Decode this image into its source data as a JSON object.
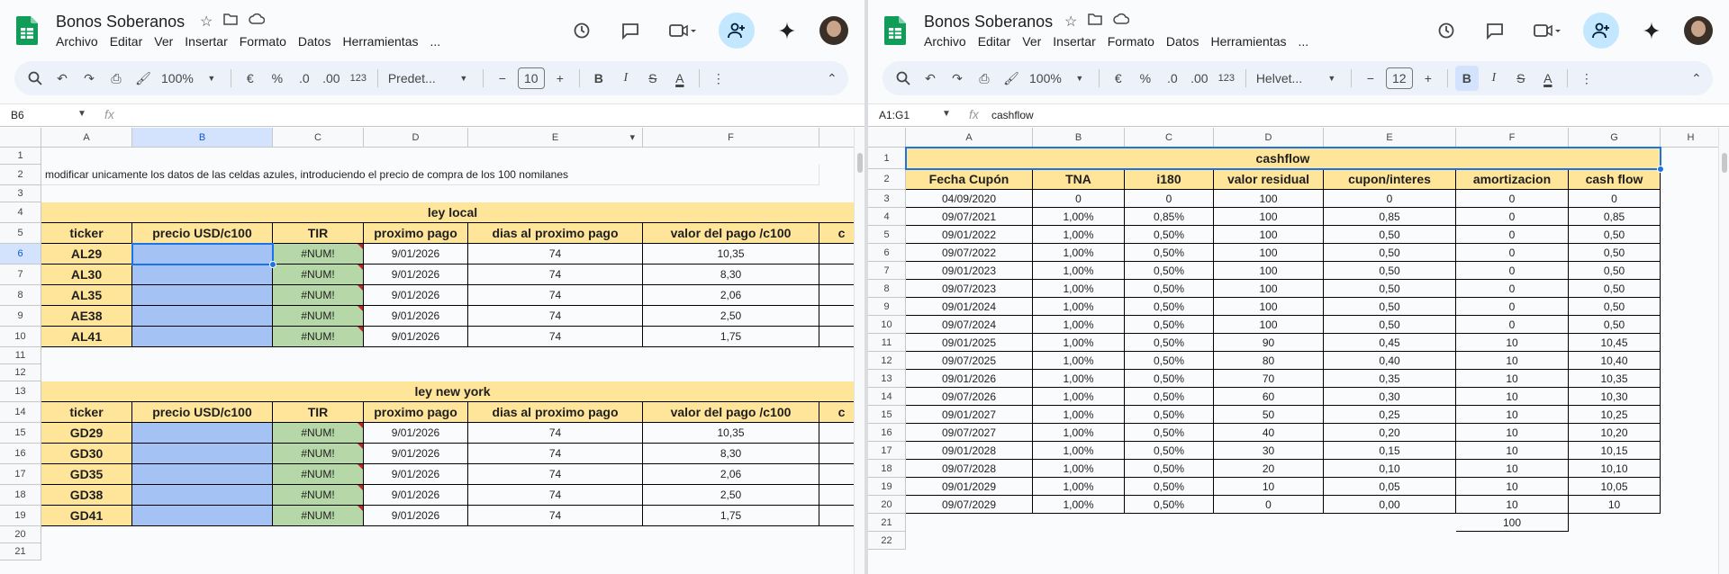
{
  "colors": {
    "accent": "#1a73e8",
    "yellow": "#ffe599",
    "blue_cell": "#a4c2f4",
    "green_cell": "#b6d7a8",
    "sheets_green": "#0f9d58"
  },
  "left": {
    "title": "Bonos Soberanos",
    "menus": [
      "Archivo",
      "Editar",
      "Ver",
      "Insertar",
      "Formato",
      "Datos",
      "Herramientas",
      "..."
    ],
    "toolbar": {
      "zoom": "100%",
      "currency": "€",
      "percent": "%",
      "dec_less": ".0",
      "dec_more": ".00",
      "num_format": "123",
      "font": "Predet...",
      "font_size": "10",
      "bold": "B",
      "italic": "I",
      "strike": "S",
      "textcolor": "A"
    },
    "namebox": "B6",
    "formula": "",
    "cols": [
      "A",
      "B",
      "C",
      "D",
      "E",
      "F",
      ""
    ],
    "rows": [
      "1",
      "2",
      "3",
      "4",
      "5",
      "6",
      "7",
      "8",
      "9",
      "10",
      "11",
      "12",
      "13",
      "14",
      "15",
      "16",
      "17",
      "18",
      "19",
      "20",
      "21"
    ],
    "note": "modificar unicamente los datos de las celdas azules, introduciendo el precio de compra de los 100 nomilanes",
    "sections": [
      {
        "title": "ley local",
        "headers": [
          "ticker",
          "precio USD/c100",
          "TIR",
          "proximo pago",
          "dias al proximo pago",
          "valor del pago /c100",
          "c"
        ],
        "rows": [
          [
            "AL29",
            "",
            "#NUM!",
            "9/01/2026",
            "74",
            "10,35"
          ],
          [
            "AL30",
            "",
            "#NUM!",
            "9/01/2026",
            "74",
            "8,30"
          ],
          [
            "AL35",
            "",
            "#NUM!",
            "9/01/2026",
            "74",
            "2,06"
          ],
          [
            "AE38",
            "",
            "#NUM!",
            "9/01/2026",
            "74",
            "2,50"
          ],
          [
            "AL41",
            "",
            "#NUM!",
            "9/01/2026",
            "74",
            "1,75"
          ]
        ]
      },
      {
        "title": "ley new york",
        "headers": [
          "ticker",
          "precio USD/c100",
          "TIR",
          "proximo pago",
          "dias al proximo pago",
          "valor del pago /c100",
          "c"
        ],
        "rows": [
          [
            "GD29",
            "",
            "#NUM!",
            "9/01/2026",
            "74",
            "10,35"
          ],
          [
            "GD30",
            "",
            "#NUM!",
            "9/01/2026",
            "74",
            "8,30"
          ],
          [
            "GD35",
            "",
            "#NUM!",
            "9/01/2026",
            "74",
            "2,06"
          ],
          [
            "GD38",
            "",
            "#NUM!",
            "9/01/2026",
            "74",
            "2,50"
          ],
          [
            "GD41",
            "",
            "#NUM!",
            "9/01/2026",
            "74",
            "1,75"
          ]
        ]
      }
    ]
  },
  "right": {
    "title": "Bonos Soberanos",
    "menus": [
      "Archivo",
      "Editar",
      "Ver",
      "Insertar",
      "Formato",
      "Datos",
      "Herramientas",
      "..."
    ],
    "toolbar": {
      "zoom": "100%",
      "currency": "€",
      "percent": "%",
      "dec_less": ".0",
      "dec_more": ".00",
      "num_format": "123",
      "font": "Helvet...",
      "font_size": "12",
      "bold": "B",
      "italic": "I",
      "strike": "S",
      "textcolor": "A"
    },
    "namebox": "A1:G1",
    "formula": "cashflow",
    "cols": [
      "A",
      "B",
      "C",
      "D",
      "E",
      "F",
      "G",
      "H"
    ],
    "rows": [
      "1",
      "2",
      "3",
      "4",
      "5",
      "6",
      "7",
      "8",
      "9",
      "10",
      "11",
      "12",
      "13",
      "14",
      "15",
      "16",
      "17",
      "18",
      "19",
      "20",
      "21",
      "22"
    ],
    "table_title": "cashflow",
    "headers": [
      "Fecha Cupón",
      "TNA",
      "i180",
      "valor residual",
      "cupon/interes",
      "amortizacion",
      "cash flow"
    ],
    "data": [
      [
        "04/09/2020",
        "0",
        "0",
        "100",
        "0",
        "0",
        "0"
      ],
      [
        "09/07/2021",
        "1,00%",
        "0,85%",
        "100",
        "0,85",
        "0",
        "0,85"
      ],
      [
        "09/01/2022",
        "1,00%",
        "0,50%",
        "100",
        "0,50",
        "0",
        "0,50"
      ],
      [
        "09/07/2022",
        "1,00%",
        "0,50%",
        "100",
        "0,50",
        "0",
        "0,50"
      ],
      [
        "09/01/2023",
        "1,00%",
        "0,50%",
        "100",
        "0,50",
        "0",
        "0,50"
      ],
      [
        "09/07/2023",
        "1,00%",
        "0,50%",
        "100",
        "0,50",
        "0",
        "0,50"
      ],
      [
        "09/01/2024",
        "1,00%",
        "0,50%",
        "100",
        "0,50",
        "0",
        "0,50"
      ],
      [
        "09/07/2024",
        "1,00%",
        "0,50%",
        "100",
        "0,50",
        "0",
        "0,50"
      ],
      [
        "09/01/2025",
        "1,00%",
        "0,50%",
        "90",
        "0,45",
        "10",
        "10,45"
      ],
      [
        "09/07/2025",
        "1,00%",
        "0,50%",
        "80",
        "0,40",
        "10",
        "10,40"
      ],
      [
        "09/01/2026",
        "1,00%",
        "0,50%",
        "70",
        "0,35",
        "10",
        "10,35"
      ],
      [
        "09/07/2026",
        "1,00%",
        "0,50%",
        "60",
        "0,30",
        "10",
        "10,30"
      ],
      [
        "09/01/2027",
        "1,00%",
        "0,50%",
        "50",
        "0,25",
        "10",
        "10,25"
      ],
      [
        "09/07/2027",
        "1,00%",
        "0,50%",
        "40",
        "0,20",
        "10",
        "10,20"
      ],
      [
        "09/01/2028",
        "1,00%",
        "0,50%",
        "30",
        "0,15",
        "10",
        "10,15"
      ],
      [
        "09/07/2028",
        "1,00%",
        "0,50%",
        "20",
        "0,10",
        "10",
        "10,10"
      ],
      [
        "09/01/2029",
        "1,00%",
        "0,50%",
        "10",
        "0,05",
        "10",
        "10,05"
      ],
      [
        "09/07/2029",
        "1,00%",
        "0,50%",
        "0",
        "0,00",
        "10",
        "10"
      ]
    ],
    "total": "100"
  }
}
